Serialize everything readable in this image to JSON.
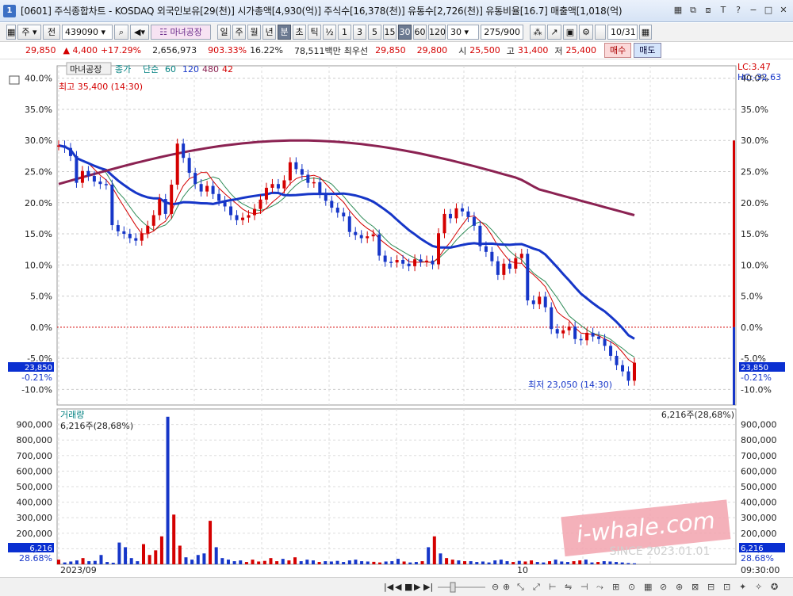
{
  "window": {
    "badge": "1",
    "title": "[0601] 주식종합차트 - KOSDAQ 외국인보유[29(천)] 시가총액[4,930(억)] 주식수[16,378(천)] 유통수[2,726(천)] 유통비율[16.7] 매출액[1,018(억)",
    "buttons": [
      "▦",
      "⧉",
      "⧈",
      "T",
      "?",
      "−",
      "□",
      "✕"
    ]
  },
  "toolbar": {
    "market": "주",
    "type": "전",
    "code": "439090",
    "name": "마녀공장",
    "periods": [
      "일",
      "주",
      "월",
      "년",
      "분",
      "초",
      "틱"
    ],
    "selected_period": "분",
    "fraction": "½",
    "minutes": [
      "1",
      "3",
      "5",
      "15",
      "30",
      "60",
      "120"
    ],
    "selected_minute": "30",
    "minute_value": "30",
    "count": "275/900",
    "date": "10/31"
  },
  "quote": {
    "price": "29,850",
    "change": "▲ 4,400",
    "change_pct": "+17.29%",
    "volume": "2,656,973",
    "volume_ratio": "903.33%",
    "turnover": "16.22%",
    "amount": "78,511백만",
    "best_label": "최우선",
    "ask": "29,850",
    "bid": "29,800",
    "open_label": "시",
    "open": "25,500",
    "high_label": "고",
    "high": "31,400",
    "low_label": "저",
    "low": "25,400",
    "buy": "매수",
    "sell": "매도"
  },
  "chart_data": [
    {
      "type": "line",
      "title": "마녀공장",
      "legend": [
        {
          "name": "종가",
          "color": "#008080"
        },
        {
          "name": "단순",
          "color": "#008080"
        },
        {
          "name": "60",
          "color": "#008080"
        },
        {
          "name": "120",
          "color": "#1636c8"
        },
        {
          "name": "480",
          "color": "#8b2252"
        },
        {
          "name": "42",
          "color": "#d40000"
        }
      ],
      "y_unit": "%",
      "ylim": [
        -12.5,
        42.0
      ],
      "y_ticks": [
        "40.0%",
        "35.0%",
        "30.0%",
        "25.0%",
        "20.0%",
        "15.0%",
        "10.0%",
        "5.0%",
        "0.0%",
        "-5.0%",
        "-10.0%"
      ],
      "right_info": {
        "lc": "LC:3.47",
        "hc": "HC:-32.63"
      },
      "current_left": "23,850",
      "current_left_pct": "-0.21%",
      "current_right": "23,850",
      "current_right_pct": "-0.21%",
      "high_annotation": "최고 35,400 (14:30)",
      "low_annotation": "최저 23,050 (14:30)",
      "price_pct": [
        29.2,
        28.8,
        27.5,
        23.2,
        25.1,
        24.3,
        23.4,
        23.0,
        22.9,
        16.4,
        15.4,
        15.0,
        14.3,
        13.9,
        15.1,
        16.3,
        18.0,
        20.6,
        18.2,
        22.9,
        29.5,
        27.2,
        24.8,
        23.0,
        21.8,
        22.7,
        21.4,
        20.3,
        19.4,
        18.0,
        17.2,
        17.6,
        18.0,
        19.0,
        20.5,
        22.4,
        23.0,
        22.3,
        23.6,
        26.5,
        25.4,
        24.5,
        23.2,
        23.3,
        21.5,
        20.3,
        19.2,
        18.4,
        17.8,
        15.3,
        14.8,
        14.3,
        14.6,
        14.9,
        11.5,
        10.5,
        10.4,
        10.8,
        10.2,
        9.8,
        10.9,
        10.5,
        10.7,
        10.1,
        15.1,
        18.2,
        17.5,
        19.1,
        18.6,
        17.7,
        16.3,
        13.0,
        12.1,
        10.6,
        8.4,
        10.2,
        9.4,
        11.1,
        11.8,
        4.3,
        3.7,
        4.9,
        3.2,
        -0.3,
        -1.0,
        -0.5,
        0.1,
        -1.9,
        -2.1,
        -0.9,
        -1.5,
        -1.9,
        -3.0,
        -4.6,
        -6.1,
        -7.1,
        -8.6,
        -5.7
      ],
      "volume_ylim": [
        0,
        1000000
      ],
      "volume_ticks": [
        "900,000",
        "800,000",
        "700,000",
        "600,000",
        "500,000",
        "400,000",
        "300,000",
        "200,000",
        "100,000"
      ],
      "volume_title": "거래량",
      "volume_current": "6,216주(28,68%)",
      "volume_current_left": "6,216",
      "volume_current_left_pct": "28.68%",
      "volumes": [
        30000,
        12000,
        18000,
        25000,
        40000,
        20000,
        22000,
        60000,
        15000,
        10000,
        140000,
        110000,
        40000,
        20000,
        130000,
        60000,
        90000,
        180000,
        950000,
        320000,
        120000,
        45000,
        30000,
        60000,
        70000,
        280000,
        110000,
        40000,
        30000,
        20000,
        25000,
        15000,
        30000,
        18000,
        22000,
        40000,
        20000,
        35000,
        25000,
        45000,
        20000,
        30000,
        25000,
        15000,
        20000,
        18000,
        22000,
        15000,
        25000,
        30000,
        20000,
        18000,
        16000,
        12000,
        18000,
        20000,
        35000,
        18000,
        12000,
        15000,
        20000,
        110000,
        180000,
        70000,
        40000,
        30000,
        25000,
        20000,
        20000,
        15000,
        18000,
        12000,
        25000,
        30000,
        20000,
        15000,
        22000,
        18000,
        25000,
        15000,
        12000,
        20000,
        30000,
        18000,
        15000,
        20000,
        25000,
        30000,
        12000,
        15000,
        20000,
        18000,
        15000,
        12000,
        8000,
        6216
      ],
      "x_labels": {
        "start": "2023/09",
        "mid": "10",
        "end": "09:30:00"
      }
    }
  ],
  "watermark": {
    "text": "i-whale.com",
    "since": "SINCE 2023.01.01"
  }
}
